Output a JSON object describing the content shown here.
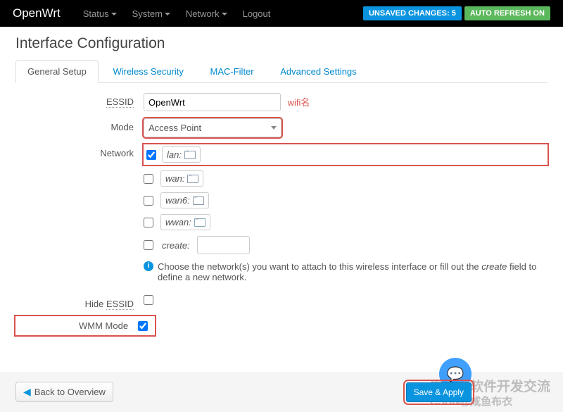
{
  "navbar": {
    "brand": "OpenWrt",
    "items": [
      "Status",
      "System",
      "Network"
    ],
    "logout": "Logout",
    "unsaved": "UNSAVED CHANGES: 5",
    "autorefresh": "AUTO REFRESH ON"
  },
  "page": {
    "title": "Interface Configuration"
  },
  "tabs": {
    "general": "General Setup",
    "wireless": "Wireless Security",
    "mac": "MAC-Filter",
    "advanced": "Advanced Settings"
  },
  "form": {
    "essid": {
      "label": "ESSID",
      "value": "OpenWrt",
      "annotation": "wifi名"
    },
    "mode": {
      "label": "Mode",
      "value": "Access Point"
    },
    "network": {
      "label": "Network",
      "options": {
        "lan": "lan:",
        "wan": "wan:",
        "wan6": "wan6:",
        "wwan": "wwan:",
        "create": "create:"
      },
      "help_prefix": "Choose the network(s) you want to attach to this wireless interface or fill out the ",
      "help_italic": "create",
      "help_suffix": " field to define a new network."
    },
    "hide_essid": {
      "label": "Hide ESSID"
    },
    "wmm": {
      "label": "WMM Mode"
    }
  },
  "footer": {
    "back": "Back to Overview",
    "apply": "Save & Apply"
  },
  "watermark": {
    "text1": "嵌入式软件开发交流",
    "text2": "CSDN@咸鱼布衣"
  }
}
